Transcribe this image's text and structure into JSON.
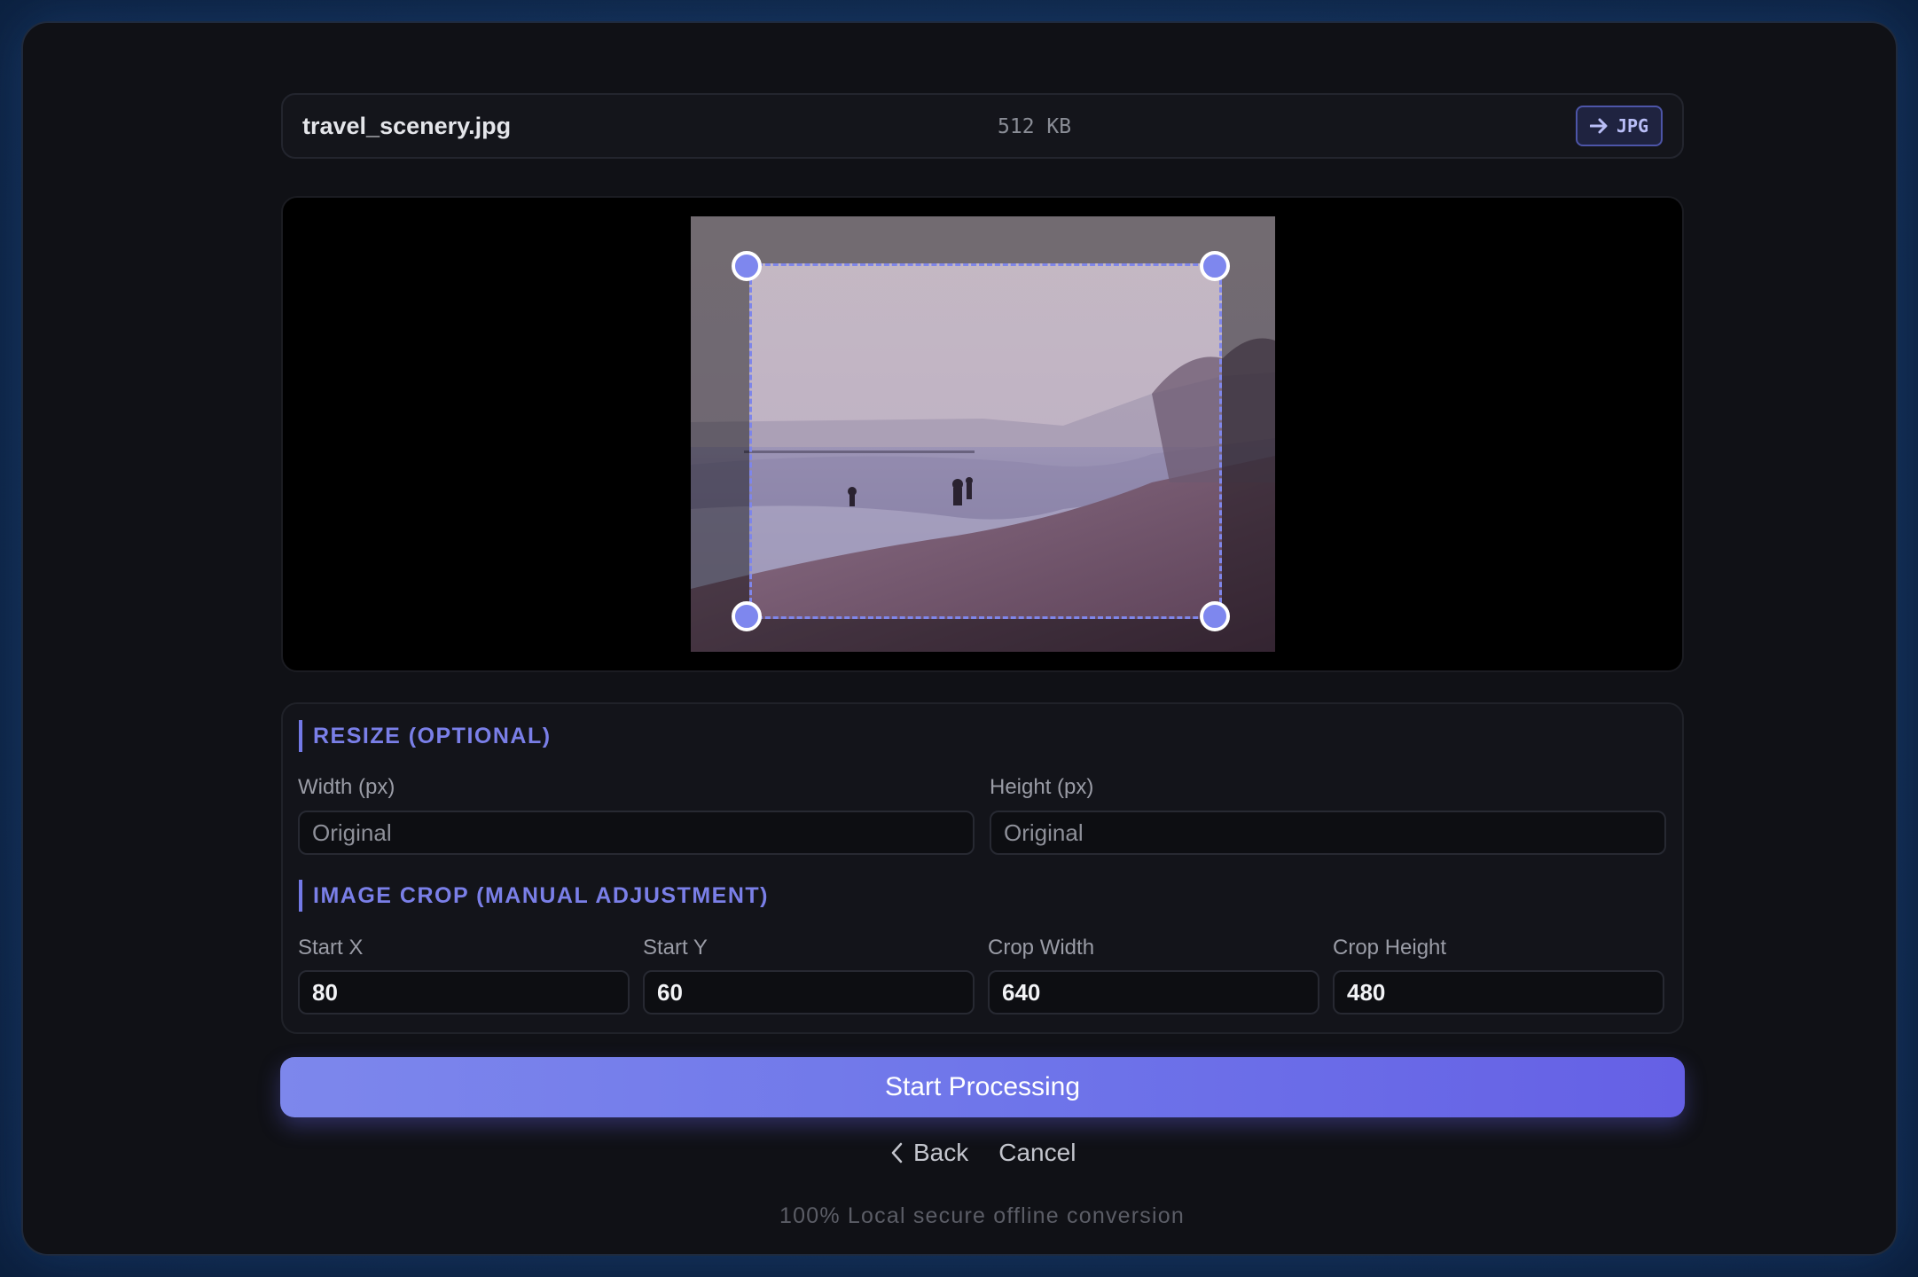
{
  "file": {
    "name": "travel_scenery.jpg",
    "size": "512 KB",
    "target_format": "JPG",
    "arrow_icon": "arrow-right-icon"
  },
  "preview": {
    "image_description_icon": "beach-photo",
    "accent_color": "#7e87ee"
  },
  "resize": {
    "title": "RESIZE (OPTIONAL)",
    "width_label": "Width (px)",
    "width_placeholder": "Original",
    "width_value": "",
    "height_label": "Height (px)",
    "height_placeholder": "Original",
    "height_value": ""
  },
  "crop": {
    "title": "IMAGE CROP (MANUAL ADJUSTMENT)",
    "start_x_label": "Start X",
    "start_x_value": "80",
    "start_y_label": "Start Y",
    "start_y_value": "60",
    "crop_width_label": "Crop Width",
    "crop_width_value": "640",
    "crop_height_label": "Crop Height",
    "crop_height_value": "480"
  },
  "actions": {
    "start_label": "Start Processing",
    "back_label": "Back",
    "back_icon": "chevron-left-icon",
    "cancel_label": "Cancel"
  },
  "footer": {
    "note": "100% Local secure offline conversion"
  },
  "colors": {
    "accent": "#7379e6",
    "button_start": "#7d87ec",
    "button_end": "#6560e5",
    "background": "#0f2748",
    "panel": "#101116"
  }
}
